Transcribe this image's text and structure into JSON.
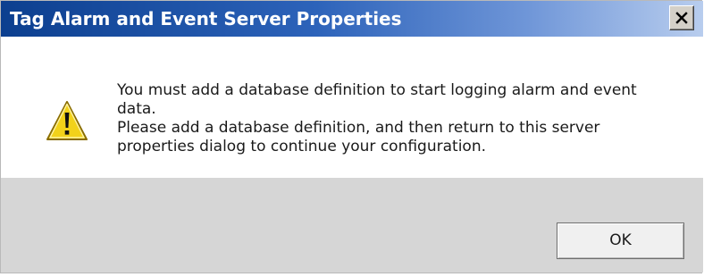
{
  "window": {
    "title": "Tag Alarm and Event Server Properties"
  },
  "message": {
    "line1": "You must add a database definition to start logging alarm and event data.",
    "line2": "Please add a database definition, and then return to this server properties dialog to continue your configuration."
  },
  "buttons": {
    "ok_label": "OK"
  },
  "icons": {
    "message_icon": "warning-icon",
    "close_icon": "close-icon"
  },
  "colors": {
    "titlebar_start": "#0c3f8f",
    "titlebar_end": "#b8cdee",
    "warning_yellow": "#f2d21a",
    "footer_gray": "#d6d6d6"
  }
}
